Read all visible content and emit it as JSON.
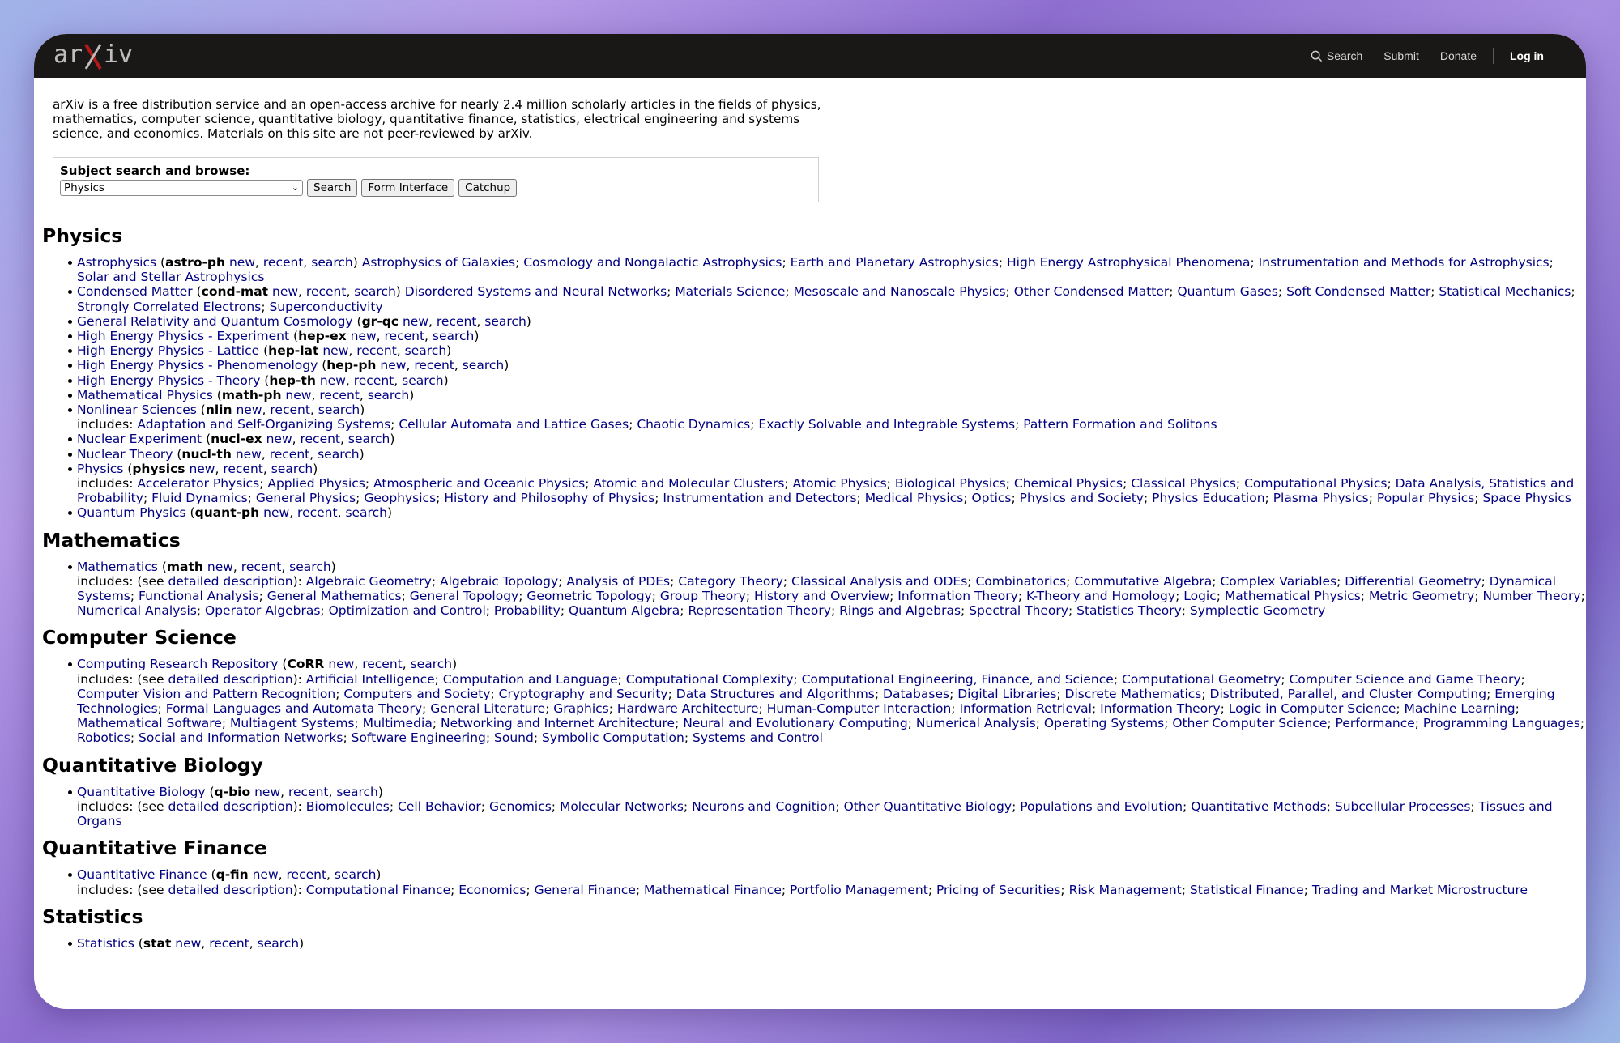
{
  "header": {
    "logo_text": "arXiv",
    "nav": {
      "search": "Search",
      "submit": "Submit",
      "donate": "Donate",
      "login": "Log in"
    }
  },
  "intro": "arXiv is a free distribution service and an open-access archive for nearly 2.4 million scholarly articles in the fields of physics, mathematics, computer science, quantitative biology, quantitative finance, statistics, electrical engineering and systems science, and economics. Materials on this site are not peer-reviewed by arXiv.",
  "subject_search": {
    "label": "Subject search and browse:",
    "selected": "Physics",
    "search_button": "Search",
    "form_button": "Form Interface",
    "catchup_button": "Catchup"
  },
  "sections": {
    "physics": {
      "title": "Physics",
      "items": [
        {
          "name": "Astrophysics",
          "code": "astro-ph",
          "includes_prefix": "",
          "subs": "Astrophysics of Galaxies; Cosmology and Nongalactic Astrophysics; Earth and Planetary Astrophysics; High Energy Astrophysical Phenomena; Instrumentation and Methods for Astrophysics; Solar and Stellar Astrophysics",
          "inline": true
        },
        {
          "name": "Condensed Matter",
          "code": "cond-mat",
          "subs": "Disordered Systems and Neural Networks; Materials Science; Mesoscale and Nanoscale Physics; Other Condensed Matter; Quantum Gases; Soft Condensed Matter; Statistical Mechanics; Strongly Correlated Electrons; Superconductivity",
          "inline": true
        },
        {
          "name": "General Relativity and Quantum Cosmology",
          "code": "gr-qc"
        },
        {
          "name": "High Energy Physics - Experiment",
          "code": "hep-ex"
        },
        {
          "name": "High Energy Physics - Lattice",
          "code": "hep-lat"
        },
        {
          "name": "High Energy Physics - Phenomenology",
          "code": "hep-ph"
        },
        {
          "name": "High Energy Physics - Theory",
          "code": "hep-th"
        },
        {
          "name": "Mathematical Physics",
          "code": "math-ph"
        },
        {
          "name": "Nonlinear Sciences",
          "code": "nlin",
          "includes": "includes: ",
          "subs": "Adaptation and Self-Organizing Systems; Cellular Automata and Lattice Gases; Chaotic Dynamics; Exactly Solvable and Integrable Systems; Pattern Formation and Solitons"
        },
        {
          "name": "Nuclear Experiment",
          "code": "nucl-ex"
        },
        {
          "name": "Nuclear Theory",
          "code": "nucl-th"
        },
        {
          "name": "Physics",
          "code": "physics",
          "includes": "includes: ",
          "subs": "Accelerator Physics; Applied Physics; Atmospheric and Oceanic Physics; Atomic and Molecular Clusters; Atomic Physics; Biological Physics; Chemical Physics; Classical Physics; Computational Physics; Data Analysis, Statistics and Probability; Fluid Dynamics; General Physics; Geophysics; History and Philosophy of Physics; Instrumentation and Detectors; Medical Physics; Optics; Physics and Society; Physics Education; Plasma Physics; Popular Physics; Space Physics"
        },
        {
          "name": "Quantum Physics",
          "code": "quant-ph"
        }
      ]
    },
    "mathematics": {
      "title": "Mathematics",
      "items": [
        {
          "name": "Mathematics",
          "code": "math",
          "includes": "includes: (see ",
          "detail": "detailed description",
          "subs": "Algebraic Geometry; Algebraic Topology; Analysis of PDEs; Category Theory; Classical Analysis and ODEs; Combinatorics; Commutative Algebra; Complex Variables; Differential Geometry; Dynamical Systems; Functional Analysis; General Mathematics; General Topology; Geometric Topology; Group Theory; History and Overview; Information Theory; K-Theory and Homology; Logic; Mathematical Physics; Metric Geometry; Number Theory; Numerical Analysis; Operator Algebras; Optimization and Control; Probability; Quantum Algebra; Representation Theory; Rings and Algebras; Spectral Theory; Statistics Theory; Symplectic Geometry"
        }
      ]
    },
    "cs": {
      "title": "Computer Science",
      "items": [
        {
          "name": "Computing Research Repository",
          "code": "CoRR",
          "includes": "includes: (see ",
          "detail": "detailed description",
          "subs": "Artificial Intelligence; Computation and Language; Computational Complexity; Computational Engineering, Finance, and Science; Computational Geometry; Computer Science and Game Theory; Computer Vision and Pattern Recognition; Computers and Society; Cryptography and Security; Data Structures and Algorithms; Databases; Digital Libraries; Discrete Mathematics; Distributed, Parallel, and Cluster Computing; Emerging Technologies; Formal Languages and Automata Theory; General Literature; Graphics; Hardware Architecture; Human-Computer Interaction; Information Retrieval; Information Theory; Logic in Computer Science; Machine Learning; Mathematical Software; Multiagent Systems; Multimedia; Networking and Internet Architecture; Neural and Evolutionary Computing; Numerical Analysis; Operating Systems; Other Computer Science; Performance; Programming Languages; Robotics; Social and Information Networks; Software Engineering; Sound; Symbolic Computation; Systems and Control"
        }
      ]
    },
    "qbio": {
      "title": "Quantitative Biology",
      "items": [
        {
          "name": "Quantitative Biology",
          "code": "q-bio",
          "includes": "includes: (see ",
          "detail": "detailed description",
          "subs": "Biomolecules; Cell Behavior; Genomics; Molecular Networks; Neurons and Cognition; Other Quantitative Biology; Populations and Evolution; Quantitative Methods; Subcellular Processes; Tissues and Organs"
        }
      ]
    },
    "qfin": {
      "title": "Quantitative Finance",
      "items": [
        {
          "name": "Quantitative Finance",
          "code": "q-fin",
          "includes": "includes: (see ",
          "detail": "detailed description",
          "subs": "Computational Finance; Economics; General Finance; Mathematical Finance; Portfolio Management; Pricing of Securities; Risk Management; Statistical Finance; Trading and Market Microstructure"
        }
      ]
    },
    "stat": {
      "title": "Statistics",
      "items": [
        {
          "name": "Statistics",
          "code": "stat"
        }
      ]
    }
  },
  "link_words": {
    "new": "new",
    "recent": "recent",
    "search": "search"
  }
}
